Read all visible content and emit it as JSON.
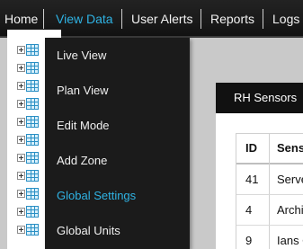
{
  "nav": {
    "items": [
      {
        "label": "Home"
      },
      {
        "label": "View Data"
      },
      {
        "label": "User Alerts"
      },
      {
        "label": "Reports"
      },
      {
        "label": "Logs"
      }
    ],
    "active_index": 1,
    "active_color": "#2fb3e4"
  },
  "dropdown": {
    "items": [
      {
        "label": "Live View"
      },
      {
        "label": "Plan View"
      },
      {
        "label": "Edit Mode"
      },
      {
        "label": "Add Zone"
      },
      {
        "label": "Global Settings"
      },
      {
        "label": "Global Units"
      }
    ],
    "hover_index": 4
  },
  "tree": {
    "rows": 11
  },
  "panel": {
    "title": "RH Sensors",
    "table": {
      "headers": [
        "ID",
        "Senso"
      ],
      "rows": [
        [
          "41",
          "Serve"
        ],
        [
          "4",
          "Archiv"
        ],
        [
          "9",
          "Ians C"
        ]
      ]
    }
  },
  "colors": {
    "navbar": "#1a1a1a",
    "accent": "#2fb3e4",
    "background": "#c9c9c9"
  }
}
